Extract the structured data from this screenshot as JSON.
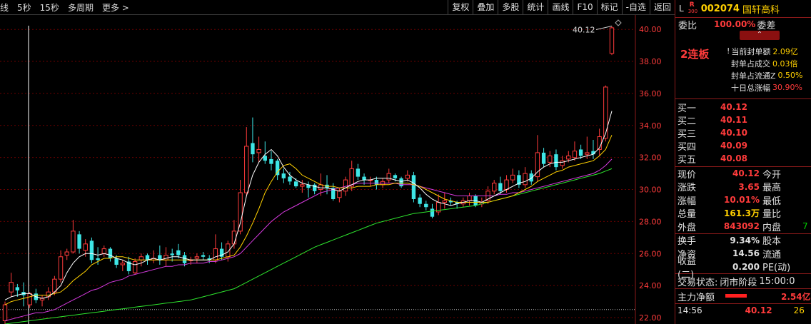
{
  "toolbar": {
    "left": [
      "线",
      "5秒",
      "15秒",
      "多周期",
      "更多 >"
    ],
    "right": [
      "复权",
      "叠加",
      "多股",
      "统计",
      "画线",
      "F10",
      "标记",
      "-自选",
      "返回"
    ]
  },
  "stock": {
    "prefix": "L",
    "badge_r": "R",
    "badge_num": "300",
    "code": "002074",
    "name": "国轩高科"
  },
  "weibi": {
    "label": "委比",
    "value": "100.00%",
    "diff_label": "委差"
  },
  "collapse_icon": "chevron-up-icon",
  "fengdan": {
    "lianban": "2连板",
    "rows": [
      {
        "label": "当前封单额",
        "value": "2.09亿",
        "marker": "!"
      },
      {
        "label": "封单占成交",
        "value": "0.03倍"
      },
      {
        "label": "封单占流通Z",
        "value": "0.50%"
      },
      {
        "label": "十日总涨幅",
        "value": "30.90%",
        "red": true
      }
    ]
  },
  "orderbook": [
    {
      "label": "买一",
      "price": "40.12"
    },
    {
      "label": "买二",
      "price": "40.11"
    },
    {
      "label": "买三",
      "price": "40.10"
    },
    {
      "label": "买四",
      "price": "40.09"
    },
    {
      "label": "买五",
      "price": "40.08"
    }
  ],
  "quote": [
    {
      "l": "现价",
      "v": "40.12",
      "c": "red",
      "l2": "今开"
    },
    {
      "l": "涨跌",
      "v": "3.65",
      "c": "red",
      "l2": "最高"
    },
    {
      "l": "涨幅",
      "v": "10.01%",
      "c": "red",
      "l2": "最低"
    },
    {
      "l": "总量",
      "v": "161.3万",
      "c": "yellow",
      "l2": "量比"
    },
    {
      "l": "外盘",
      "v": "843092",
      "c": "red",
      "l2": "内盘",
      "v2": "7"
    }
  ],
  "quote2": [
    {
      "l": "换手",
      "v": "9.34%",
      "l2": "股本"
    },
    {
      "l": "净资",
      "v": "14.56",
      "l2": "流通"
    },
    {
      "l": "收益(二)",
      "v": "0.200",
      "l2": "PE(动)"
    }
  ],
  "status": {
    "label": "交易状态:",
    "value": "闭市阶段",
    "time": "15:00:0"
  },
  "zhuli": {
    "label": "主力净额",
    "value": "2.54亿"
  },
  "tick": {
    "time": "14:56",
    "price": "40.12",
    "vol": "26"
  },
  "colors": {
    "up": "#ff3b3b",
    "down": "#3ee6e6",
    "ma5": "#ffffff",
    "ma10": "#ffd000",
    "ma20": "#d63adf",
    "ma60": "#2ee62e",
    "grid": "#6b0000"
  },
  "chart_data": {
    "type": "candlestick",
    "y_ticks": [
      "40.00",
      "38.00",
      "36.00",
      "34.00",
      "32.00",
      "30.00",
      "28.00",
      "26.00",
      "24.00",
      "22.00"
    ],
    "ylim": [
      21.6,
      40.9
    ],
    "annotation": {
      "label": "40.12",
      "value": 40.12
    },
    "dashed_level": 22.5,
    "candles": [
      [
        21.8,
        22.8,
        21.6,
        23.0
      ],
      [
        23.6,
        24.2,
        23.3,
        24.8
      ],
      [
        23.9,
        23.7,
        23.3,
        24.1
      ],
      [
        23.6,
        23.4,
        22.7,
        24.2
      ],
      [
        22.8,
        23.5,
        22.6,
        23.6
      ],
      [
        23.5,
        23.1,
        22.9,
        23.8
      ],
      [
        23.1,
        23.2,
        22.7,
        23.4
      ],
      [
        23.3,
        23.6,
        23.1,
        23.9
      ],
      [
        23.6,
        24.4,
        23.4,
        24.6
      ],
      [
        24.4,
        25.8,
        24.2,
        26.2
      ],
      [
        25.9,
        26.1,
        25.6,
        26.3
      ],
      [
        26.1,
        27.4,
        26.0,
        28.1
      ],
      [
        27.2,
        26.3,
        26.0,
        27.4
      ],
      [
        26.2,
        26.6,
        25.8,
        26.9
      ],
      [
        26.8,
        25.6,
        25.4,
        27.0
      ],
      [
        25.7,
        25.6,
        25.3,
        26.4
      ],
      [
        26.0,
        26.3,
        25.8,
        26.5
      ],
      [
        26.3,
        25.7,
        25.5,
        26.4
      ],
      [
        25.7,
        25.3,
        25.1,
        25.9
      ],
      [
        25.3,
        25.4,
        24.9,
        25.6
      ],
      [
        25.5,
        24.9,
        24.7,
        25.8
      ],
      [
        24.8,
        25.5,
        24.7,
        25.7
      ],
      [
        25.6,
        25.8,
        25.2,
        26.0
      ],
      [
        25.9,
        25.6,
        25.3,
        26.0
      ],
      [
        25.6,
        25.7,
        25.4,
        26.2
      ],
      [
        25.9,
        25.6,
        25.3,
        26.5
      ],
      [
        25.6,
        25.9,
        25.2,
        26.4
      ],
      [
        26.0,
        25.9,
        25.5,
        26.3
      ],
      [
        26.2,
        25.9,
        25.7,
        26.6
      ],
      [
        25.9,
        25.4,
        25.2,
        26.1
      ],
      [
        25.6,
        25.6,
        25.3,
        25.8
      ],
      [
        25.7,
        25.8,
        25.4,
        26.0
      ],
      [
        25.9,
        25.8,
        25.6,
        26.1
      ],
      [
        25.7,
        25.6,
        25.4,
        25.9
      ],
      [
        25.6,
        26.3,
        25.4,
        27.2
      ],
      [
        26.3,
        25.8,
        25.6,
        26.7
      ],
      [
        25.8,
        26.6,
        25.5,
        26.8
      ],
      [
        26.6,
        27.4,
        26.3,
        28.1
      ],
      [
        27.4,
        29.8,
        27.2,
        30.6
      ],
      [
        29.8,
        32.7,
        29.6,
        33.9
      ],
      [
        32.9,
        32.2,
        31.7,
        34.5
      ],
      [
        32.3,
        32.5,
        31.7,
        33.3
      ],
      [
        32.1,
        31.8,
        31.6,
        33.0
      ],
      [
        31.9,
        31.6,
        31.2,
        32.4
      ],
      [
        31.8,
        30.9,
        30.6,
        31.9
      ],
      [
        31.0,
        30.7,
        30.4,
        31.3
      ],
      [
        30.8,
        30.5,
        30.3,
        31.1
      ],
      [
        30.5,
        30.2,
        30.1,
        30.7
      ],
      [
        30.2,
        30.3,
        29.8,
        30.6
      ],
      [
        30.3,
        30.1,
        29.5,
        30.5
      ],
      [
        30.3,
        29.9,
        29.7,
        30.4
      ],
      [
        30.0,
        30.3,
        29.6,
        31.0
      ],
      [
        30.3,
        30.1,
        29.7,
        30.9
      ],
      [
        30.1,
        29.4,
        29.3,
        30.4
      ],
      [
        29.5,
        29.9,
        29.2,
        30.1
      ],
      [
        29.9,
        30.6,
        29.6,
        30.8
      ],
      [
        30.2,
        31.3,
        29.9,
        31.8
      ],
      [
        31.3,
        30.8,
        30.6,
        31.6
      ],
      [
        30.8,
        30.6,
        30.3,
        31.0
      ],
      [
        30.6,
        30.6,
        30.2,
        30.8
      ],
      [
        30.6,
        30.3,
        30.0,
        30.8
      ],
      [
        30.3,
        30.5,
        30.1,
        30.7
      ],
      [
        30.6,
        31.0,
        30.4,
        31.3
      ],
      [
        30.9,
        30.7,
        30.5,
        31.0
      ],
      [
        30.7,
        30.2,
        30.1,
        30.8
      ],
      [
        30.7,
        30.9,
        30.5,
        31.2
      ],
      [
        30.9,
        29.4,
        29.2,
        31.1
      ],
      [
        29.5,
        29.1,
        28.9,
        29.7
      ],
      [
        29.1,
        28.9,
        28.7,
        29.3
      ],
      [
        28.8,
        28.3,
        28.2,
        29.1
      ],
      [
        28.6,
        29.2,
        28.4,
        29.7
      ],
      [
        29.2,
        29.3,
        28.8,
        29.8
      ],
      [
        29.3,
        29.2,
        29.0,
        29.5
      ],
      [
        29.2,
        29.1,
        28.8,
        29.3
      ],
      [
        29.1,
        29.3,
        28.9,
        29.5
      ],
      [
        29.3,
        29.6,
        29.0,
        29.8
      ],
      [
        29.6,
        29.0,
        28.9,
        29.7
      ],
      [
        29.1,
        29.2,
        28.9,
        29.5
      ],
      [
        29.3,
        29.9,
        29.1,
        30.2
      ],
      [
        29.9,
        30.4,
        29.7,
        30.6
      ],
      [
        30.4,
        29.9,
        29.7,
        30.8
      ],
      [
        30.0,
        30.6,
        29.8,
        30.9
      ],
      [
        30.6,
        30.9,
        30.4,
        31.3
      ],
      [
        30.9,
        30.3,
        30.1,
        31.2
      ],
      [
        30.3,
        31.0,
        30.1,
        31.4
      ],
      [
        31.0,
        30.5,
        30.3,
        31.2
      ],
      [
        30.8,
        32.3,
        30.5,
        33.4
      ],
      [
        32.3,
        31.6,
        31.4,
        32.6
      ],
      [
        31.7,
        32.1,
        31.4,
        32.4
      ],
      [
        32.2,
        31.4,
        31.2,
        32.5
      ],
      [
        31.5,
        31.8,
        31.3,
        32.1
      ],
      [
        31.9,
        32.1,
        31.7,
        32.4
      ],
      [
        32.0,
        32.4,
        31.8,
        33.0
      ],
      [
        32.5,
        32.1,
        31.9,
        32.8
      ],
      [
        32.2,
        32.3,
        31.9,
        33.3
      ],
      [
        32.4,
        32.2,
        31.9,
        33.1
      ],
      [
        32.5,
        33.3,
        32.1,
        33.8
      ],
      [
        33.2,
        36.4,
        33.0,
        36.5
      ],
      [
        38.5,
        40.1,
        38.4,
        40.2
      ]
    ],
    "ma5": [
      23.1,
      23.3,
      23.4,
      23.5,
      23.5,
      23.3,
      23.2,
      23.3,
      23.6,
      24.0,
      24.8,
      25.4,
      25.8,
      26.0,
      26.0,
      25.9,
      26.0,
      25.9,
      25.7,
      25.6,
      25.4,
      25.3,
      25.4,
      25.6,
      25.7,
      25.6,
      25.7,
      25.8,
      25.8,
      25.7,
      25.6,
      25.6,
      25.6,
      25.6,
      25.8,
      25.9,
      26.1,
      26.6,
      27.9,
      29.6,
      30.9,
      31.7,
      32.2,
      32.5,
      32.1,
      31.4,
      30.9,
      30.6,
      30.4,
      30.3,
      30.2,
      30.1,
      30.1,
      30.0,
      29.9,
      30.1,
      30.3,
      30.5,
      30.6,
      30.6,
      30.7,
      30.7,
      30.7,
      30.6,
      30.5,
      30.6,
      30.4,
      30.1,
      29.7,
      29.4,
      29.2,
      29.1,
      29.0,
      29.1,
      29.2,
      29.3,
      29.3,
      29.2,
      29.4,
      29.6,
      29.8,
      30.0,
      30.2,
      30.4,
      30.5,
      30.7,
      31.1,
      31.4,
      31.6,
      31.7,
      31.7,
      31.8,
      31.9,
      32.0,
      32.1,
      32.2,
      32.6,
      33.5,
      34.9
    ],
    "ma10": [
      22.8,
      23.0,
      23.1,
      23.2,
      23.3,
      23.4,
      23.4,
      23.4,
      23.5,
      23.6,
      23.9,
      24.3,
      24.6,
      24.9,
      25.3,
      25.5,
      25.7,
      25.7,
      25.8,
      25.8,
      25.7,
      25.6,
      25.6,
      25.6,
      25.6,
      25.6,
      25.6,
      25.6,
      25.6,
      25.6,
      25.6,
      25.6,
      25.6,
      25.6,
      25.6,
      25.7,
      25.8,
      25.9,
      26.4,
      27.1,
      27.9,
      28.8,
      29.8,
      30.5,
      31.1,
      31.5,
      31.6,
      31.3,
      30.9,
      30.7,
      30.5,
      30.3,
      30.2,
      30.2,
      30.1,
      30.1,
      30.1,
      30.2,
      30.2,
      30.2,
      30.3,
      30.3,
      30.3,
      30.4,
      30.4,
      30.4,
      30.3,
      30.2,
      30.0,
      29.8,
      29.6,
      29.4,
      29.3,
      29.2,
      29.2,
      29.2,
      29.2,
      29.2,
      29.2,
      29.3,
      29.4,
      29.5,
      29.6,
      29.8,
      30.0,
      30.2,
      30.5,
      30.7,
      30.9,
      31.1,
      31.2,
      31.4,
      31.5,
      31.6,
      31.7,
      31.8,
      32.1,
      32.5,
      33.4
    ],
    "ma20": [
      21.8,
      21.9,
      22.0,
      22.1,
      22.2,
      22.3,
      22.3,
      22.4,
      22.5,
      22.7,
      22.9,
      23.1,
      23.3,
      23.5,
      23.7,
      23.8,
      24.0,
      24.2,
      24.3,
      24.4,
      24.6,
      24.7,
      24.8,
      24.9,
      25.0,
      25.1,
      25.2,
      25.2,
      25.3,
      25.3,
      25.4,
      25.4,
      25.4,
      25.5,
      25.5,
      25.6,
      25.7,
      25.8,
      26.0,
      26.4,
      26.8,
      27.2,
      27.6,
      28.0,
      28.3,
      28.6,
      28.8,
      29.0,
      29.2,
      29.4,
      29.6,
      29.8,
      29.9,
      30.0,
      30.1,
      30.2,
      30.3,
      30.4,
      30.4,
      30.4,
      30.4,
      30.4,
      30.4,
      30.4,
      30.3,
      30.3,
      30.3,
      30.2,
      30.1,
      30.0,
      29.9,
      29.8,
      29.7,
      29.6,
      29.6,
      29.6,
      29.6,
      29.6,
      29.6,
      29.6,
      29.7,
      29.7,
      29.8,
      29.8,
      29.9,
      30.0,
      30.1,
      30.2,
      30.3,
      30.4,
      30.5,
      30.6,
      30.7,
      30.8,
      30.9,
      31.0,
      31.2,
      31.5,
      31.9
    ],
    "ma60": [
      21.6,
      21.65,
      21.7,
      21.75,
      21.8,
      21.85,
      21.9,
      21.95,
      22.0,
      22.05,
      22.1,
      22.15,
      22.2,
      22.25,
      22.3,
      22.35,
      22.4,
      22.45,
      22.5,
      22.55,
      22.6,
      22.65,
      22.7,
      22.75,
      22.8,
      22.85,
      22.9,
      22.95,
      23.0,
      23.05,
      23.1,
      23.2,
      23.3,
      23.4,
      23.5,
      23.6,
      23.7,
      23.8,
      24.0,
      24.2,
      24.4,
      24.6,
      24.8,
      25.0,
      25.2,
      25.4,
      25.6,
      25.8,
      26.0,
      26.2,
      26.4,
      26.55,
      26.7,
      26.85,
      27.0,
      27.15,
      27.3,
      27.45,
      27.6,
      27.75,
      27.9,
      28.0,
      28.1,
      28.2,
      28.3,
      28.4,
      28.5,
      28.55,
      28.6,
      28.65,
      28.7,
      28.75,
      28.8,
      28.85,
      28.9,
      28.95,
      29.0,
      29.1,
      29.2,
      29.3,
      29.4,
      29.5,
      29.6,
      29.7,
      29.8,
      29.9,
      30.0,
      30.1,
      30.2,
      30.3,
      30.4,
      30.5,
      30.6,
      30.7,
      30.8,
      30.9,
      31.0,
      31.15,
      31.3
    ]
  }
}
